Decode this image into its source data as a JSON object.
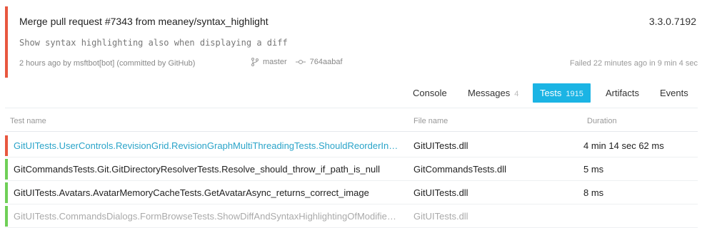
{
  "commit": {
    "title": "Merge pull request #7343 from meaney/syntax_highlight",
    "version": "3.3.0.7192",
    "description": "Show syntax highlighting also when displaying a diff",
    "meta": "2 hours ago by msftbot[bot] (committed by GitHub)",
    "branch": "master",
    "sha": "764aabaf",
    "status_text": "Failed 22 minutes ago in 9 min 4 sec",
    "status_color": "#e8573f"
  },
  "tabs": [
    {
      "label": "Console",
      "count": ""
    },
    {
      "label": "Messages",
      "count": "4"
    },
    {
      "label": "Tests",
      "count": "1915"
    },
    {
      "label": "Artifacts",
      "count": ""
    },
    {
      "label": "Events",
      "count": ""
    }
  ],
  "active_tab": "Tests",
  "accent_color": "#1bb4e4",
  "table": {
    "columns": {
      "name": "Test name",
      "file": "File name",
      "duration": "Duration"
    },
    "rows": [
      {
        "name": "GitUITests.UserControls.RevisionGrid.RevisionGraphMultiThreadingTests.ShouldReorderInTopoOrder",
        "file": "GitUITests.dll",
        "duration": "4 min 14 sec 62 ms",
        "outcome": "failed"
      },
      {
        "name": "GitCommandsTests.Git.GitDirectoryResolverTests.Resolve_should_throw_if_path_is_null",
        "file": "GitCommandsTests.dll",
        "duration": "5 ms",
        "outcome": "passed"
      },
      {
        "name": "GitUITests.Avatars.AvatarMemoryCacheTests.GetAvatarAsync_returns_correct_image",
        "file": "GitUITests.dll",
        "duration": "8 ms",
        "outcome": "passed"
      },
      {
        "name": "GitUITests.CommandsDialogs.FormBrowseTests.ShowDiffAndSyntaxHighlightingOfModifiedFile",
        "file": "GitUITests.dll",
        "duration": "",
        "outcome": "passed"
      }
    ]
  }
}
